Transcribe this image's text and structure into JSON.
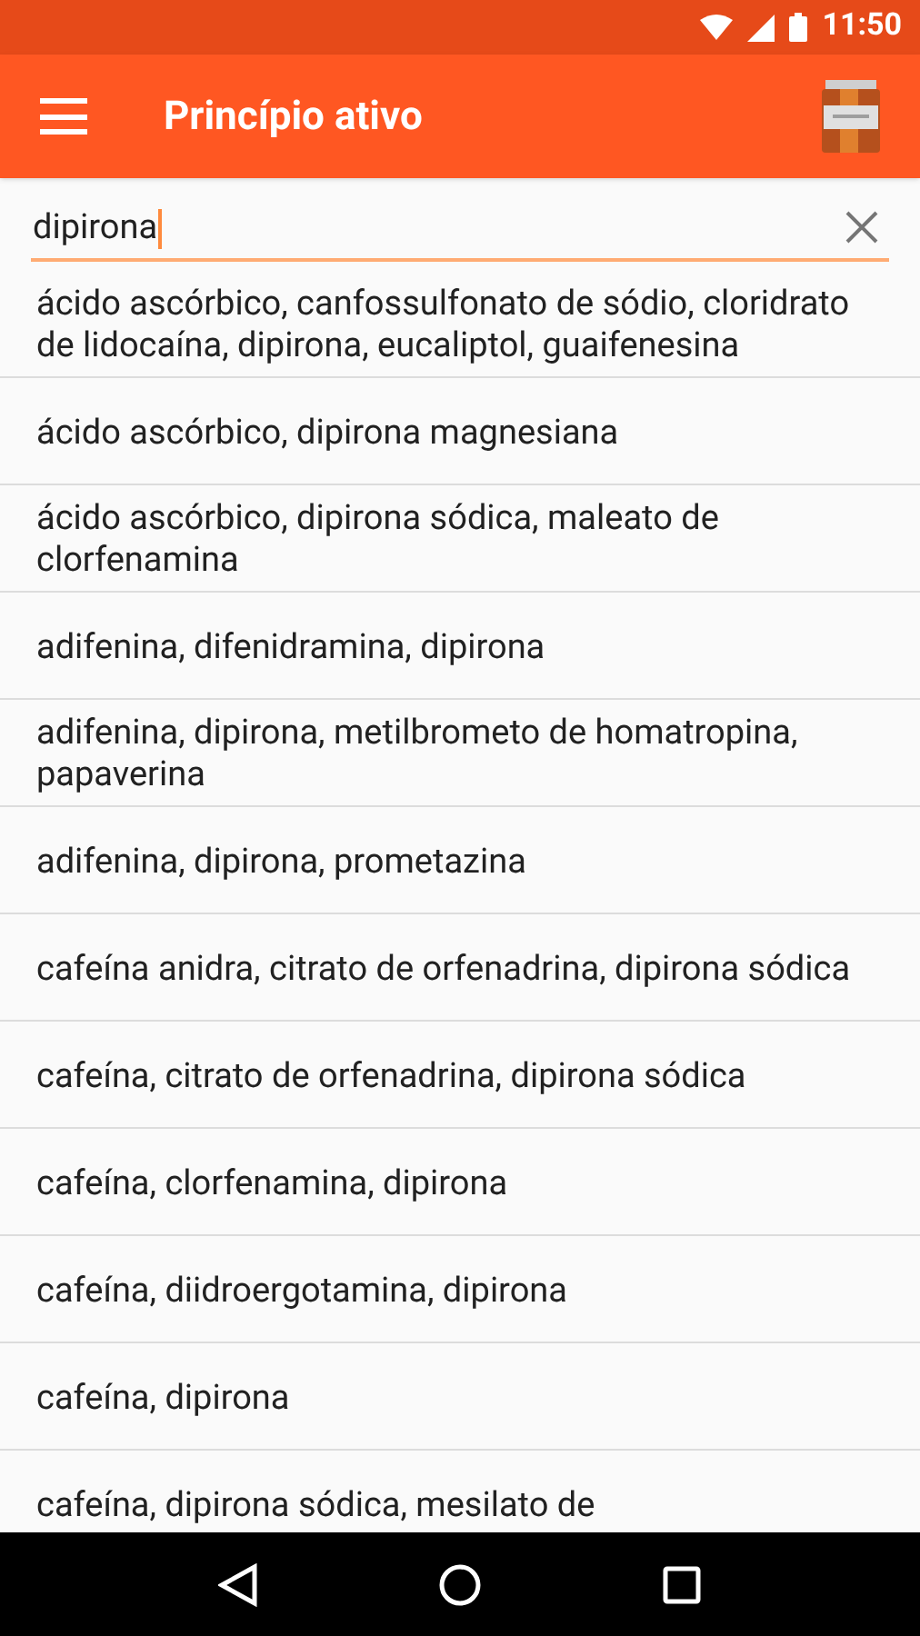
{
  "status_bar": {
    "time": "11:50"
  },
  "app_bar": {
    "title": "Princípio ativo"
  },
  "search": {
    "value": "dipirona"
  },
  "results": [
    {
      "text": "ácido ascórbico, canfossulfonato de sódio, cloridrato de lidocaína, dipirona, eucaliptol, guaifenesina"
    },
    {
      "text": "ácido ascórbico, dipirona magnesiana"
    },
    {
      "text": "ácido ascórbico, dipirona sódica, maleato de clorfenamina"
    },
    {
      "text": "adifenina, difenidramina, dipirona"
    },
    {
      "text": "adifenina, dipirona, metilbrometo de homatropina, papaverina"
    },
    {
      "text": "adifenina, dipirona, prometazina"
    },
    {
      "text": "cafeína anidra, citrato de orfenadrina, dipirona sódica"
    },
    {
      "text": "cafeína, citrato de orfenadrina, dipirona sódica"
    },
    {
      "text": "cafeína, clorfenamina, dipirona"
    },
    {
      "text": "cafeína, diidroergotamina, dipirona"
    },
    {
      "text": "cafeína, dipirona"
    },
    {
      "text": "cafeína, dipirona sódica, mesilato de"
    }
  ]
}
